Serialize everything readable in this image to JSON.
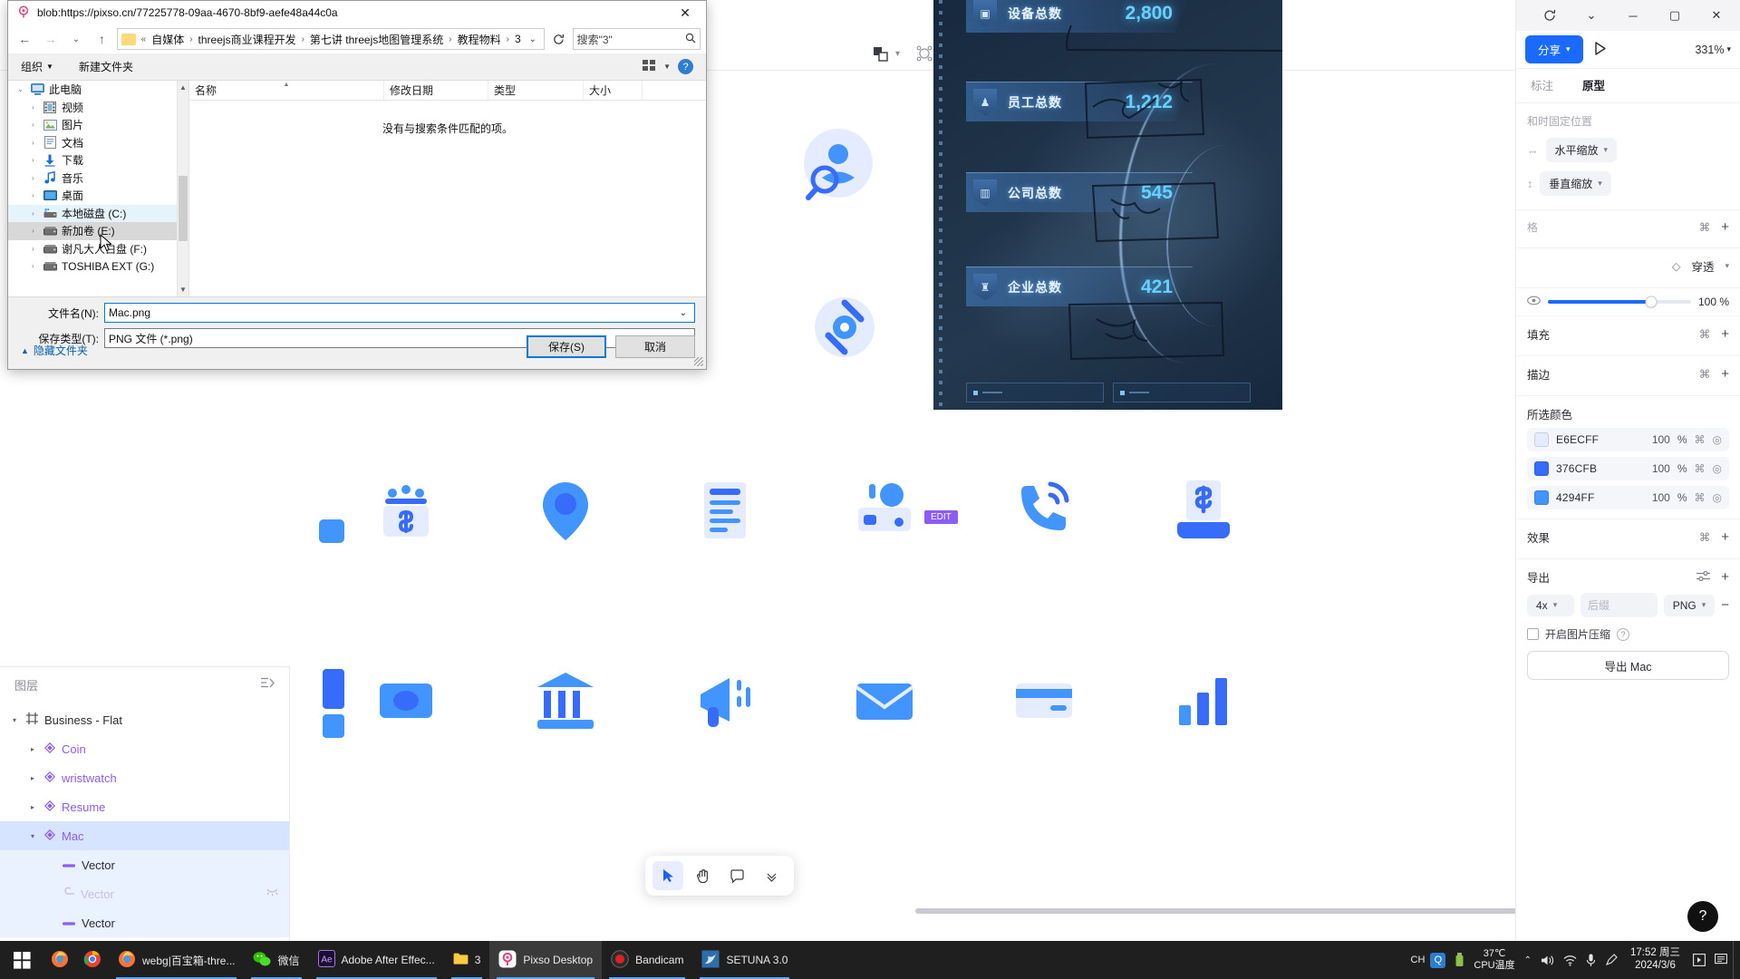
{
  "pixso": {
    "toolbar": {
      "boolean_icon": "boolean-ops-icon",
      "mask_icon": "mask-icon",
      "contrast_icon": "contrast-icon",
      "crop_icon": "crop-icon",
      "ai_icon": "ai-icon"
    },
    "layers_panel": {
      "title": "图层",
      "collapse_icon": "collapse-all-icon",
      "items": [
        {
          "label": "Business - Flat",
          "icon": "frame-icon",
          "level": 0,
          "expanded": true,
          "selected": false,
          "style": "dark"
        },
        {
          "label": "Coin",
          "icon": "component-icon",
          "level": 1,
          "expanded": false,
          "selected": false,
          "style": "purple"
        },
        {
          "label": "wristwatch",
          "icon": "component-icon",
          "level": 1,
          "expanded": false,
          "selected": false,
          "style": "purple"
        },
        {
          "label": "Resume",
          "icon": "component-icon",
          "level": 1,
          "expanded": false,
          "selected": false,
          "style": "purple"
        },
        {
          "label": "Mac",
          "icon": "component-icon",
          "level": 1,
          "expanded": true,
          "selected": true,
          "style": "purple"
        },
        {
          "label": "Vector",
          "icon": "vector-icon",
          "level": 2,
          "expanded": false,
          "selected": false,
          "style": "dark"
        },
        {
          "label": "Vector",
          "icon": "vector-icon-dim",
          "level": 2,
          "expanded": false,
          "selected": false,
          "style": "dim",
          "hidden_icon": "hidden-eye-icon"
        },
        {
          "label": "Vector",
          "icon": "vector-icon",
          "level": 2,
          "expanded": false,
          "selected": false,
          "style": "dark"
        }
      ]
    },
    "canvas": {
      "edit_tag": "EDIT",
      "toolbar": [
        {
          "icon": "cursor-icon",
          "active": true
        },
        {
          "icon": "hand-icon",
          "active": false
        },
        {
          "icon": "comment-icon",
          "active": false
        },
        {
          "icon": "chevron-down-icon",
          "active": false
        }
      ],
      "icons_row1": [
        "coin-dollar-icon",
        "location-pin-icon",
        "document-lines-icon",
        "projector-icon",
        "phone-call-icon",
        "money-hand-icon"
      ],
      "icons_row2": [
        "banknote-icon",
        "bank-icon",
        "megaphone-icon",
        "envelope-icon",
        "credit-card-icon",
        "bar-chart-icon"
      ],
      "top_icons": [
        "user-search-icon",
        "satellite-icon"
      ]
    },
    "right_panel": {
      "window_buttons": [
        "refresh-icon",
        "chevron-down-icon",
        "minimize-icon",
        "maximize-icon",
        "close-icon"
      ],
      "share_label": "分享",
      "play_icon": "play-icon",
      "zoom_level": "331%",
      "tabs": [
        {
          "label": "标注",
          "active": false
        },
        {
          "label": "原型",
          "active": true
        }
      ],
      "constraints": {
        "note": "和时固定位置",
        "horizontal": "水平缩放",
        "vertical": "垂直缩放"
      },
      "layout_grid_label": "格",
      "blend_mode": "穿透",
      "opacity": "100 %",
      "eye_icon": "visibility-icon",
      "sections": [
        {
          "title": "填充",
          "detach_icon": "detach-icon",
          "add_icon": "plus-icon"
        },
        {
          "title": "描边",
          "detach_icon": "detach-icon",
          "add_icon": "plus-icon"
        }
      ],
      "selected_colors": {
        "title": "所选颜色",
        "items": [
          {
            "hex": "E6ECFF",
            "opacity": "100",
            "unit": "%",
            "swatch": "#E6ECFF"
          },
          {
            "hex": "376CFB",
            "opacity": "100",
            "unit": "%",
            "swatch": "#376CFB"
          },
          {
            "hex": "4294FF",
            "opacity": "100",
            "unit": "%",
            "swatch": "#4294FF"
          }
        ]
      },
      "effects": {
        "title": "效果",
        "detach_icon": "detach-icon",
        "add_icon": "plus-icon"
      },
      "export": {
        "title": "导出",
        "settings_icon": "sliders-icon",
        "add_icon": "plus-icon",
        "scale": "4x",
        "suffix_placeholder": "后缀",
        "format": "PNG",
        "remove_icon": "minus-icon",
        "compress_label": "开启图片压缩",
        "help_icon": "question-icon",
        "button_label": "导出 Mac"
      },
      "help_fab": "?"
    }
  },
  "video_overlay": {
    "stats": [
      {
        "label": "设备总数",
        "value": "2,800",
        "icon": "device-icon"
      },
      {
        "label": "员工总数",
        "value": "1,212",
        "icon": "people-icon"
      },
      {
        "label": "公司总数",
        "value": "545",
        "icon": "building-icon"
      },
      {
        "label": "企业总数",
        "value": "421",
        "icon": "enterprise-icon"
      }
    ]
  },
  "save_dialog": {
    "title": "blob:https://pixso.cn/77225778-09aa-4670-8bf9-aefe48a44c0a",
    "title_icon": "pixso-logo-icon",
    "close_icon": "close-icon",
    "nav": {
      "back_icon": "arrow-left-icon",
      "forward_icon": "arrow-right-icon",
      "recent_icon": "chevron-down-icon",
      "up_icon": "arrow-up-icon",
      "refresh_icon": "refresh-icon",
      "overflow": "«",
      "breadcrumbs": [
        "自媒体",
        "threejs商业课程开发",
        "第七讲 threejs地图管理系统",
        "教程物料",
        "3"
      ],
      "search_value": "搜索\"3\"",
      "search_icon": "search-icon"
    },
    "commandbar": {
      "organize": "组织",
      "new_folder": "新建文件夹",
      "view_icon": "view-layout-icon",
      "view_caret": "chevron-down-icon",
      "help": "?"
    },
    "tree": [
      {
        "label": "此电脑",
        "icon": "computer-icon",
        "level": 0,
        "expanded": true,
        "state": ""
      },
      {
        "label": "视频",
        "icon": "video-icon",
        "level": 1,
        "expanded": false,
        "state": ""
      },
      {
        "label": "图片",
        "icon": "pictures-icon",
        "level": 1,
        "expanded": false,
        "state": ""
      },
      {
        "label": "文档",
        "icon": "documents-icon",
        "level": 1,
        "expanded": false,
        "state": ""
      },
      {
        "label": "下载",
        "icon": "downloads-icon",
        "level": 1,
        "expanded": false,
        "state": ""
      },
      {
        "label": "音乐",
        "icon": "music-icon",
        "level": 1,
        "expanded": false,
        "state": ""
      },
      {
        "label": "桌面",
        "icon": "desktop-icon",
        "level": 1,
        "expanded": false,
        "state": ""
      },
      {
        "label": "本地磁盘 (C:)",
        "icon": "harddisk-icon",
        "level": 1,
        "expanded": false,
        "state": "sel-light"
      },
      {
        "label": "新加卷 (E:)",
        "icon": "drive-icon",
        "level": 1,
        "expanded": false,
        "state": "sel-grey2"
      },
      {
        "label": "谢凡大人白盘 (F:)",
        "icon": "drive-icon",
        "level": 1,
        "expanded": false,
        "state": ""
      },
      {
        "label": "TOSHIBA EXT (G:)",
        "icon": "drive-icon",
        "level": 1,
        "expanded": false,
        "state": ""
      }
    ],
    "columns": [
      "名称",
      "修改日期",
      "类型",
      "大小"
    ],
    "empty_message": "没有与搜索条件匹配的项。",
    "filename_label": "文件名(N):",
    "filename_value": "Mac.png",
    "filetype_label": "保存类型(T):",
    "filetype_value": "PNG 文件 (*.png)",
    "save_button": "保存(S)",
    "cancel_button": "取消",
    "hide_folders": "隐藏文件夹",
    "hide_folders_icon": "chevron-up-icon"
  },
  "taskbar": {
    "start_icon": "windows-start-icon",
    "items": [
      {
        "label": "",
        "icon": "firefox-icon",
        "running": false,
        "active": false
      },
      {
        "label": "",
        "icon": "chrome-icon",
        "running": false,
        "active": false
      },
      {
        "label": "webg|百宝箱-thre...",
        "icon": "firefox-icon",
        "running": true,
        "active": false
      },
      {
        "label": "微信",
        "icon": "wechat-icon",
        "running": true,
        "active": false
      },
      {
        "label": "Adobe After Effec...",
        "icon": "ae-icon",
        "running": true,
        "active": false
      },
      {
        "label": "3",
        "icon": "folder-icon",
        "running": true,
        "active": false
      },
      {
        "label": "Pixso Desktop",
        "icon": "pixso-icon",
        "running": true,
        "active": true
      },
      {
        "label": "Bandicam",
        "icon": "bandicam-icon",
        "running": true,
        "active": false
      },
      {
        "label": "SETUNA 3.0",
        "icon": "setuna-icon",
        "running": true,
        "active": false
      }
    ],
    "tray": {
      "ime": "CH",
      "qq_icon": "qq-icon",
      "usb_icon": "usb-icon",
      "cpu_temp": "37℃",
      "cpu_label": "CPU温度",
      "chevron_up_icon": "chevron-up-icon",
      "volume_icon": "volume-icon",
      "network_icon": "network-icon",
      "mic_icon": "microphone-icon",
      "pen_icon": "pen-icon",
      "time": "17:52 周三",
      "date": "2024/3/6",
      "action_center_icon": "action-center-icon",
      "notes_icon": "notes-icon"
    }
  }
}
